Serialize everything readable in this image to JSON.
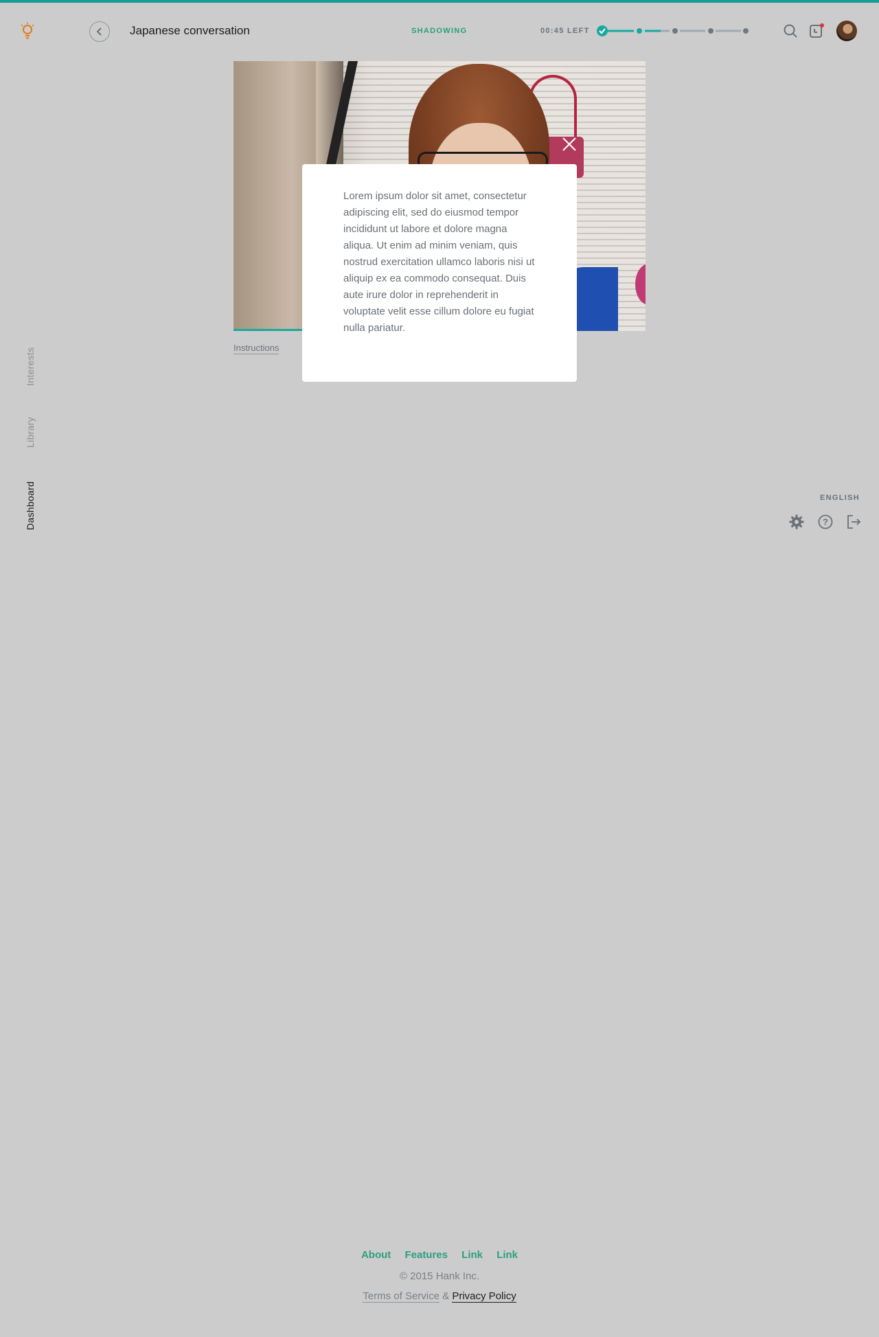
{
  "header": {
    "title": "Japanese conversation",
    "mode": "SHADOWING",
    "time_left": "00:45 LEFT",
    "progress": {
      "steps_total": 5,
      "steps_completed": 1,
      "current_step": 2
    }
  },
  "side_nav": {
    "items": [
      {
        "label": "Interests",
        "active": false
      },
      {
        "label": "Library",
        "active": false
      },
      {
        "label": "Dashboard",
        "active": true
      }
    ]
  },
  "video": {
    "playback_fraction": 0.17
  },
  "instructions_link": "Instructions",
  "modal": {
    "body": "Lorem ipsum dolor sit amet, consectetur adipiscing elit, sed do eiusmod tempor incididunt ut labore et dolore magna aliqua. Ut enim ad minim veniam, quis nostrud exercitation ullamco laboris nisi ut aliquip ex ea commodo consequat. Duis aute irure dolor in reprehenderit in voluptate velit esse cillum dolore eu fugiat nulla pariatur."
  },
  "utility": {
    "language": "ENGLISH"
  },
  "footer": {
    "links": [
      "About",
      "Features",
      "Link",
      "Link"
    ],
    "copyright": "© 2015 Hank Inc.",
    "terms": "Terms of Service",
    "ampersand": "&",
    "privacy": "Privacy Policy"
  },
  "colors": {
    "accent_teal": "#159e93",
    "accent_green": "#27a07b",
    "logo_orange": "#e07b16",
    "notification_red": "#e0342f",
    "background": "#cccccc"
  },
  "icons": [
    "lightbulb-icon",
    "chevron-left-icon",
    "check-icon",
    "search-icon",
    "notification-icon",
    "close-icon",
    "gear-icon",
    "help-icon",
    "logout-icon"
  ]
}
